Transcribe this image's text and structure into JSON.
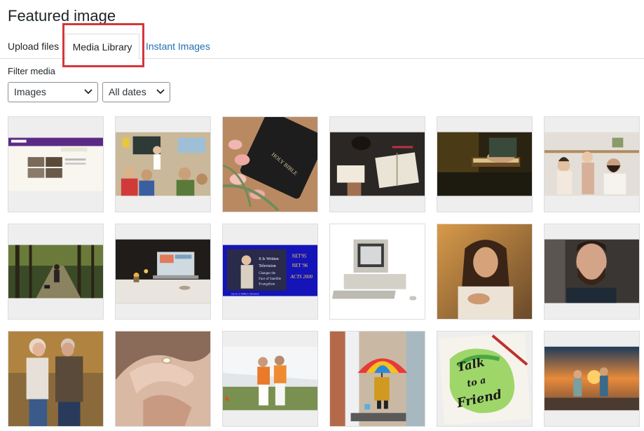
{
  "modal": {
    "title": "Featured image"
  },
  "tabs": [
    {
      "label": "Upload files"
    },
    {
      "label": "Media Library"
    },
    {
      "label": "Instant Images"
    }
  ],
  "filters": {
    "label": "Filter media",
    "type_selected": "Images",
    "date_selected": "All dates"
  },
  "colors": {
    "accent": "#2271b1",
    "highlight": "#d63638"
  },
  "media": [
    {
      "name": "website-screenshot"
    },
    {
      "name": "classroom-children"
    },
    {
      "name": "holy-bible-tulips"
    },
    {
      "name": "open-bible-desk"
    },
    {
      "name": "hands-on-bible"
    },
    {
      "name": "family-kitchen"
    },
    {
      "name": "forest-walk-dog"
    },
    {
      "name": "laptop-candles"
    },
    {
      "name": "it-is-written-television"
    },
    {
      "name": "vintage-computer"
    },
    {
      "name": "woman-portrait-sunset"
    },
    {
      "name": "bearded-man-portrait"
    },
    {
      "name": "elderly-couple"
    },
    {
      "name": "holding-hands-ring"
    },
    {
      "name": "two-women-outdoors"
    },
    {
      "name": "rainbow-umbrella"
    },
    {
      "name": "talk-to-a-friend-card"
    },
    {
      "name": "children-sunset-road"
    }
  ]
}
